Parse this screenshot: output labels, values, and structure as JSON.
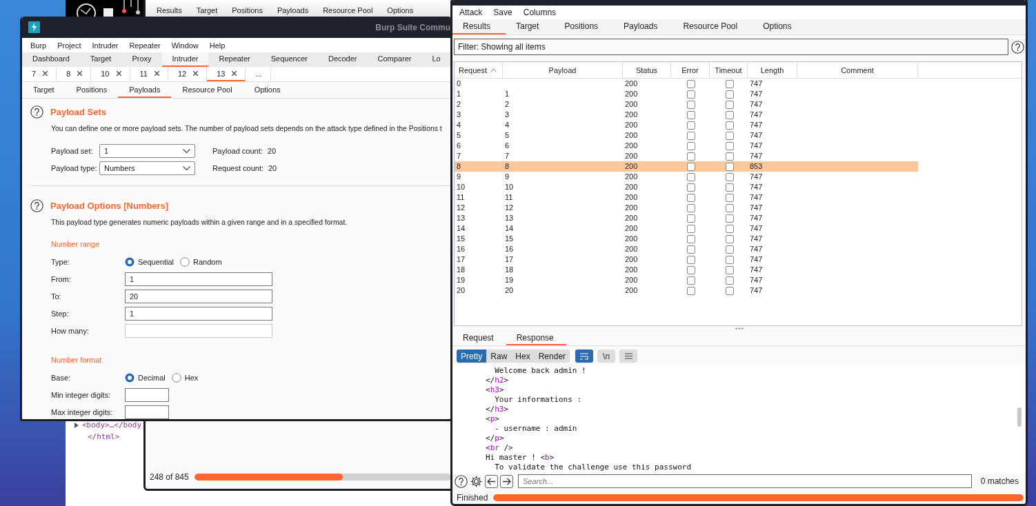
{
  "browser_window": {
    "lines": [
      {
        "text": "<body>…</body",
        "expanded": false
      },
      {
        "text": "</html>"
      }
    ]
  },
  "attack_window_back": {
    "tabs": [
      "Results",
      "Target",
      "Positions",
      "Payloads",
      "Resource Pool",
      "Options"
    ],
    "progress": {
      "text": "248 of 845",
      "level": 0.58
    }
  },
  "main_window": {
    "title": "Burp Suite Commu",
    "menu": [
      "Burp",
      "Project",
      "Intruder",
      "Repeater",
      "Window",
      "Help"
    ],
    "tabs": [
      {
        "label": "Dashboard",
        "selected": false
      },
      {
        "label": "Target",
        "selected": false
      },
      {
        "label": "Proxy",
        "selected": false
      },
      {
        "label": "Intruder",
        "selected": true
      },
      {
        "label": "Repeater",
        "selected": false
      },
      {
        "label": "Sequencer",
        "selected": false
      },
      {
        "label": "Decoder",
        "selected": false
      },
      {
        "label": "Comparer",
        "selected": false
      },
      {
        "label": "Lo",
        "selected": false
      }
    ],
    "attack_tabs": [
      {
        "label": "7",
        "closable": true,
        "selected": false
      },
      {
        "label": "8",
        "closable": true,
        "selected": false
      },
      {
        "label": "10",
        "closable": true,
        "selected": false
      },
      {
        "label": "11",
        "closable": true,
        "selected": false
      },
      {
        "label": "12",
        "closable": true,
        "selected": false
      },
      {
        "label": "13",
        "closable": true,
        "selected": true
      },
      {
        "label": "...",
        "closable": false,
        "selected": false
      }
    ],
    "sub_tabs": [
      {
        "label": "Target",
        "selected": false
      },
      {
        "label": "Positions",
        "selected": false
      },
      {
        "label": "Payloads",
        "selected": true
      },
      {
        "label": "Resource Pool",
        "selected": false
      },
      {
        "label": "Options",
        "selected": false
      }
    ],
    "payload_sets": {
      "title": "Payload Sets",
      "description": "You can define one or more payload sets. The number of payload sets depends on the attack type defined in the Positions t",
      "rows": [
        {
          "label": "Payload set:",
          "value": "1",
          "count_label": "Payload count:",
          "count": "20"
        },
        {
          "label": "Payload type:",
          "value": "Numbers",
          "count_label": "Request count:",
          "count": "20"
        }
      ]
    },
    "payload_options": {
      "title": "Payload Options [Numbers]",
      "description": "This payload type generates numeric payloads within a given range and in a specified format.",
      "number_range": {
        "heading": "Number range",
        "type": {
          "label": "Type:",
          "options": [
            {
              "label": "Sequential",
              "selected": true
            },
            {
              "label": "Random",
              "selected": false
            }
          ]
        },
        "fields": [
          {
            "label": "From:",
            "value": "1",
            "disabled": false
          },
          {
            "label": "To:",
            "value": "20",
            "disabled": false
          },
          {
            "label": "Step:",
            "value": "1",
            "disabled": false
          },
          {
            "label": "How many:",
            "disabled": true
          }
        ]
      },
      "number_format": {
        "heading": "Number format",
        "base": {
          "label": "Base:",
          "options": [
            {
              "label": "Decimal",
              "selected": true
            },
            {
              "label": "Hex",
              "selected": false
            }
          ]
        },
        "fields": [
          {
            "label": "Min integer digits:",
            "disabled": false
          },
          {
            "label": "Max integer digits:",
            "disabled": false
          }
        ]
      }
    }
  },
  "results_window": {
    "menu": [
      "Attack",
      "Save",
      "Columns"
    ],
    "tabs": [
      {
        "label": "Results",
        "selected": true
      },
      {
        "label": "Target",
        "selected": false
      },
      {
        "label": "Positions",
        "selected": false
      },
      {
        "label": "Payloads",
        "selected": false
      },
      {
        "label": "Resource Pool",
        "selected": false
      },
      {
        "label": "Options",
        "selected": false
      }
    ],
    "filter": "Filter: Showing all items",
    "columns": [
      {
        "label": "Request",
        "sorted": true
      },
      {
        "label": "Payload",
        "sorted": false
      },
      {
        "label": "Status",
        "sorted": false
      },
      {
        "label": "Error",
        "sorted": false
      },
      {
        "label": "Timeout",
        "sorted": false
      },
      {
        "label": "Length",
        "sorted": false
      },
      {
        "label": "Comment",
        "sorted": false
      }
    ],
    "rows": [
      {
        "request": "0",
        "status": "200",
        "error": false,
        "timeout": false,
        "length": "747",
        "selected": false
      },
      {
        "request": "1",
        "payload": "1",
        "status": "200",
        "error": false,
        "timeout": false,
        "length": "747",
        "selected": false
      },
      {
        "request": "2",
        "payload": "2",
        "status": "200",
        "error": false,
        "timeout": false,
        "length": "747",
        "selected": false
      },
      {
        "request": "3",
        "payload": "3",
        "status": "200",
        "error": false,
        "timeout": false,
        "length": "747",
        "selected": false
      },
      {
        "request": "4",
        "payload": "4",
        "status": "200",
        "error": false,
        "timeout": false,
        "length": "747",
        "selected": false
      },
      {
        "request": "5",
        "payload": "5",
        "status": "200",
        "error": false,
        "timeout": false,
        "length": "747",
        "selected": false
      },
      {
        "request": "6",
        "payload": "6",
        "status": "200",
        "error": false,
        "timeout": false,
        "length": "747",
        "selected": false
      },
      {
        "request": "7",
        "payload": "7",
        "status": "200",
        "error": false,
        "timeout": false,
        "length": "747",
        "selected": false
      },
      {
        "request": "8",
        "payload": "8",
        "status": "200",
        "error": false,
        "timeout": false,
        "length": "853",
        "selected": true
      },
      {
        "request": "9",
        "payload": "9",
        "status": "200",
        "error": false,
        "timeout": false,
        "length": "747",
        "selected": false
      },
      {
        "request": "10",
        "payload": "10",
        "status": "200",
        "error": false,
        "timeout": false,
        "length": "747",
        "selected": false
      },
      {
        "request": "11",
        "payload": "11",
        "status": "200",
        "error": false,
        "timeout": false,
        "length": "747",
        "selected": false
      },
      {
        "request": "12",
        "payload": "12",
        "status": "200",
        "error": false,
        "timeout": false,
        "length": "747",
        "selected": false
      },
      {
        "request": "13",
        "payload": "13",
        "status": "200",
        "error": false,
        "timeout": false,
        "length": "747",
        "selected": false
      },
      {
        "request": "14",
        "payload": "14",
        "status": "200",
        "error": false,
        "timeout": false,
        "length": "747",
        "selected": false
      },
      {
        "request": "15",
        "payload": "15",
        "status": "200",
        "error": false,
        "timeout": false,
        "length": "747",
        "selected": false
      },
      {
        "request": "16",
        "payload": "16",
        "status": "200",
        "error": false,
        "timeout": false,
        "length": "747",
        "selected": false
      },
      {
        "request": "17",
        "payload": "17",
        "status": "200",
        "error": false,
        "timeout": false,
        "length": "747",
        "selected": false
      },
      {
        "request": "18",
        "payload": "18",
        "status": "200",
        "error": false,
        "timeout": false,
        "length": "747",
        "selected": false
      },
      {
        "request": "19",
        "payload": "19",
        "status": "200",
        "error": false,
        "timeout": false,
        "length": "747",
        "selected": false
      },
      {
        "request": "20",
        "payload": "20",
        "status": "200",
        "error": false,
        "timeout": false,
        "length": "747",
        "selected": false
      }
    ],
    "message_tabs": [
      {
        "label": "Request",
        "selected": false
      },
      {
        "label": "Response",
        "selected": true
      }
    ],
    "view_buttons": [
      {
        "label": "Pretty",
        "selected": true
      },
      {
        "label": "Raw",
        "selected": false
      },
      {
        "label": "Hex",
        "selected": false
      },
      {
        "label": "Render",
        "selected": false
      }
    ],
    "tool_buttons": [
      {
        "kind": "wrap",
        "selected": true
      },
      {
        "kind": "text",
        "label": "\\n",
        "selected": false
      },
      {
        "kind": "menu",
        "selected": false
      }
    ],
    "code_lines": [
      [
        {
          "text": "  Welcome back admin !"
        }
      ],
      [
        {
          "text": "</"
        },
        {
          "text": "h2",
          "tag": true
        },
        {
          "text": ">"
        }
      ],
      [
        {
          "text": "<"
        },
        {
          "text": "h3",
          "tag": true
        },
        {
          "text": ">"
        }
      ],
      [
        {
          "text": "  Your informations :"
        }
      ],
      [
        {
          "text": "</"
        },
        {
          "text": "h3",
          "tag": true
        },
        {
          "text": ">"
        }
      ],
      [
        {
          "text": "<"
        },
        {
          "text": "p",
          "tag": true
        },
        {
          "text": ">"
        }
      ],
      [
        {
          "text": "  - username : admin"
        }
      ],
      [
        {
          "text": "</"
        },
        {
          "text": "p",
          "tag": true
        },
        {
          "text": ">"
        }
      ],
      [
        {
          "text": "<"
        },
        {
          "text": "br",
          "tag": true
        },
        {
          "text": " />"
        }
      ],
      [
        {
          "text": "Hi master ! <"
        },
        {
          "text": "b",
          "tag": true
        },
        {
          "text": ">"
        }
      ],
      [
        {
          "text": "  To validate the challenge use this password"
        }
      ]
    ],
    "search": {
      "placeholder": "Search...",
      "matches": "0 matches"
    },
    "status": {
      "text": "Finished",
      "level": 1
    }
  }
}
